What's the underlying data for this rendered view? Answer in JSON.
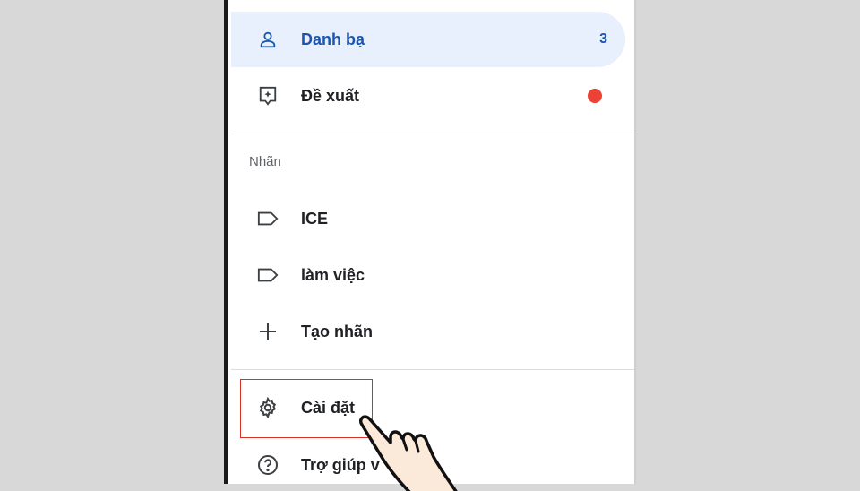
{
  "drawer": {
    "contacts": {
      "label": "Danh bạ",
      "count": "3",
      "icon": "person-icon"
    },
    "suggestions": {
      "label": "Đề xuất",
      "icon": "suggestion-icon",
      "badge_color": "#ea4335"
    },
    "labels_header": "Nhãn",
    "labels": [
      {
        "label": "ICE",
        "icon": "label-icon"
      },
      {
        "label": "làm việc",
        "icon": "label-icon"
      }
    ],
    "create_label": {
      "label": "Tạo nhãn",
      "icon": "plus-icon"
    },
    "settings": {
      "label": "Cài đặt",
      "icon": "gear-icon"
    },
    "help": {
      "label": "Trợ giúp v",
      "icon": "help-icon"
    }
  },
  "colors": {
    "accent": "#1a56b0",
    "active_bg": "#e8f0fe",
    "highlight_border": "#d93025"
  }
}
